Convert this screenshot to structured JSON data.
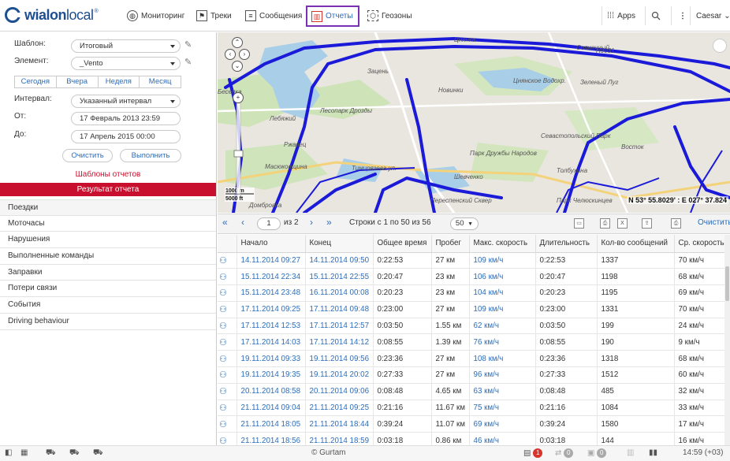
{
  "brand": {
    "name_bold": "wialon",
    "name_light": "local",
    "sup": "®"
  },
  "nav": [
    {
      "label": "Мониторинг",
      "icon": "globe-icon"
    },
    {
      "label": "Треки",
      "icon": "track-icon"
    },
    {
      "label": "Сообщения",
      "icon": "messages-icon"
    },
    {
      "label": "Отчеты",
      "icon": "reports-icon"
    },
    {
      "label": "Геозоны",
      "icon": "geofence-icon"
    }
  ],
  "topright": {
    "apps": "Apps",
    "user": "Caesar"
  },
  "form": {
    "template_label": "Шаблон:",
    "template_value": "Итоговый",
    "element_label": "Элемент:",
    "element_value": "_Vento",
    "periods": [
      "Сегодня",
      "Вчера",
      "Неделя",
      "Месяц"
    ],
    "interval_label": "Интервал:",
    "interval_value": "Указанный интервал",
    "from_label": "От:",
    "from_value": "17 Февраль 2013 23:59",
    "to_label": "До:",
    "to_value": "17 Апрель 2015 00:00",
    "clear": "Очистить",
    "run": "Выполнить"
  },
  "templates_title": "Шаблоны отчетов",
  "result_title": "Результат отчета",
  "report_items": [
    "Поездки",
    "Моточасы",
    "Нарушения",
    "Выполненные команды",
    "Заправки",
    "Потери связи",
    "События",
    "Driving behaviour"
  ],
  "map": {
    "coords": "N 53° 55.8029' : E 027° 37.824",
    "scale_m": "1000 m",
    "scale_ft": "5000 ft",
    "labels": [
      "Цнянка",
      "Солнечный",
      "Н9031",
      "Зацень",
      "Новинки",
      "Цнянское Водохр.",
      "Зеленый Луг",
      "Лесопарк Дрозды",
      "Лебяжий",
      "Ржавец",
      "Севастопольский Парк",
      "Восток",
      "Парк Дружбы Народов",
      "Масюковщина",
      "Тимирязева ул.",
      "Толбухина",
      "Шевченко",
      "Переспенский Сквер",
      "Парк Челюскинцев",
      "Домбровка",
      "Бесеяка"
    ]
  },
  "grid": {
    "page": "1",
    "of": "из 2",
    "rows_info": "Строки с 1 по 50 из 56",
    "page_size": "50",
    "clear": "Очистить",
    "columns": [
      "",
      "Начало",
      "Конец",
      "Общее время",
      "Пробег",
      "Макс. скорость",
      "Длительность",
      "Кол-во сообщений",
      "Ср. скорость"
    ],
    "rows": [
      [
        "14.11.2014 09:27",
        "14.11.2014 09:50",
        "0:22:53",
        "27 км",
        "109 км/ч",
        "0:22:53",
        "1337",
        "70 км/ч"
      ],
      [
        "15.11.2014 22:34",
        "15.11.2014 22:55",
        "0:20:47",
        "23 км",
        "106 км/ч",
        "0:20:47",
        "1198",
        "68 км/ч"
      ],
      [
        "15.11.2014 23:48",
        "16.11.2014 00:08",
        "0:20:23",
        "23 км",
        "104 км/ч",
        "0:20:23",
        "1195",
        "69 км/ч"
      ],
      [
        "17.11.2014 09:25",
        "17.11.2014 09:48",
        "0:23:00",
        "27 км",
        "109 км/ч",
        "0:23:00",
        "1331",
        "70 км/ч"
      ],
      [
        "17.11.2014 12:53",
        "17.11.2014 12:57",
        "0:03:50",
        "1.55 км",
        "62 км/ч",
        "0:03:50",
        "199",
        "24 км/ч"
      ],
      [
        "17.11.2014 14:03",
        "17.11.2014 14:12",
        "0:08:55",
        "1.39 км",
        "76 км/ч",
        "0:08:55",
        "190",
        "9 км/ч"
      ],
      [
        "19.11.2014 09:33",
        "19.11.2014 09:56",
        "0:23:36",
        "27 км",
        "108 км/ч",
        "0:23:36",
        "1318",
        "68 км/ч"
      ],
      [
        "19.11.2014 19:35",
        "19.11.2014 20:02",
        "0:27:33",
        "27 км",
        "96 км/ч",
        "0:27:33",
        "1512",
        "60 км/ч"
      ],
      [
        "20.11.2014 08:58",
        "20.11.2014 09:06",
        "0:08:48",
        "4.65 км",
        "63 км/ч",
        "0:08:48",
        "485",
        "32 км/ч"
      ],
      [
        "21.11.2014 09:04",
        "21.11.2014 09:25",
        "0:21:16",
        "11.67 км",
        "75 км/ч",
        "0:21:16",
        "1084",
        "33 км/ч"
      ],
      [
        "21.11.2014 18:05",
        "21.11.2014 18:44",
        "0:39:24",
        "11.07 км",
        "69 км/ч",
        "0:39:24",
        "1580",
        "17 км/ч"
      ],
      [
        "21.11.2014 18:56",
        "21.11.2014 18:59",
        "0:03:18",
        "0.86 км",
        "46 км/ч",
        "0:03:18",
        "144",
        "16 км/ч"
      ]
    ]
  },
  "status": {
    "copyright": "© Gurtam",
    "notif_count": "1",
    "count2": "0",
    "count3": "0",
    "time": "14:59 (+03)"
  },
  "colors": {
    "accent_red": "#c8102e",
    "link_blue": "#2b6dbb",
    "track_blue": "#1a1ad8",
    "brand_blue": "#1d4f91",
    "active_nav_border": "#7a32b4"
  }
}
